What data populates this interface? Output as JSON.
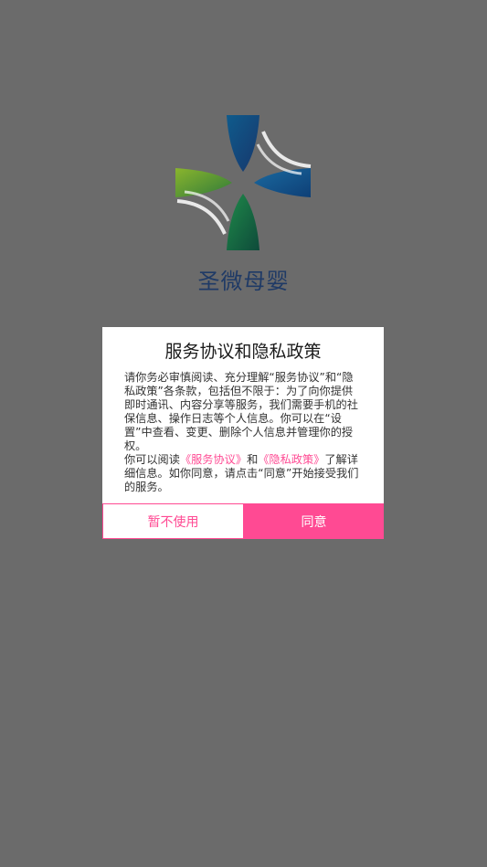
{
  "app": {
    "brand_name": "圣微母婴",
    "logo_icon": "brand-logo-icon"
  },
  "dialog": {
    "title": "服务协议和隐私政策",
    "paragraph1": "请你务必审慎阅读、充分理解“服务协议”和“隐私政策”各条款，包括但不限于：为了向你提供即时通讯、内容分享等服务，我们需要手机的社保信息、操作日志等个人信息。你可以在“设置”中查看、变更、删除个人信息并管理你的授权。",
    "paragraph2_prefix": "你可以阅读",
    "service_link": "《服务协议》",
    "and_text": "和",
    "privacy_link": "《隐私政策》",
    "paragraph2_suffix": "了解详细信息。如你同意，请点击“同意”开始接受我们的服务。",
    "decline_label": "暂不使用",
    "agree_label": "同意"
  },
  "colors": {
    "accent": "#ff4a93",
    "overlay": "#6b6b6b",
    "brand_text": "#1f3a66"
  }
}
